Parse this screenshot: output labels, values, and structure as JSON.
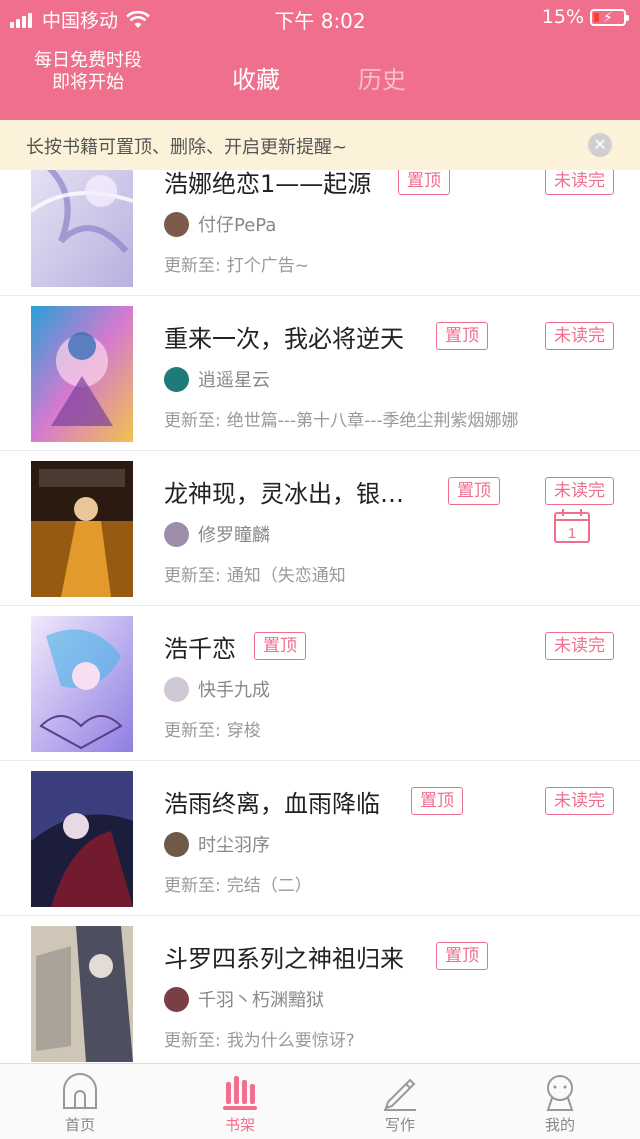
{
  "status_bar": {
    "carrier": "中国移动",
    "time": "下午 8:02",
    "battery": "15%"
  },
  "header": {
    "promo_line1": "每日免费时段",
    "promo_line2": "即将开始",
    "tabs": [
      {
        "label": "收藏",
        "active": true
      },
      {
        "label": "历史",
        "active": false
      }
    ]
  },
  "notice": {
    "text": "长按书籍可置顶、删除、开启更新提醒~"
  },
  "books": [
    {
      "title": "浩娜绝恋1——起源",
      "top_tag": "置顶",
      "unread_tag": "未读完",
      "author": "付仔PePa",
      "update_label": "更新至:",
      "update_text": "打个广告~"
    },
    {
      "title": "重来一次，我必将逆天",
      "top_tag": "置顶",
      "unread_tag": "未读完",
      "author": "逍遥星云",
      "update_label": "更新至:",
      "update_text": "绝世篇---第十八章---季绝尘荆紫烟娜娜"
    },
    {
      "title": "龙神现，灵冰出，银…",
      "top_tag": "置顶",
      "unread_tag": "未读完",
      "author": "修罗瞳麟",
      "update_label": "更新至:",
      "update_text": "通知（失恋通知",
      "calendar_number": "1"
    },
    {
      "title": "浩千恋",
      "top_tag": "置顶",
      "unread_tag": "未读完",
      "author": "快手九成",
      "update_label": "更新至:",
      "update_text": "穿梭"
    },
    {
      "title": "浩雨终离，血雨降临",
      "top_tag": "置顶",
      "unread_tag": "未读完",
      "author": "时尘羽序",
      "update_label": "更新至:",
      "update_text": "完结（二）"
    },
    {
      "title": "斗罗四系列之神祖归来",
      "top_tag": "置顶",
      "author": "千羽丶朽渊黯狱",
      "update_label": "更新至:",
      "update_text": "我为什么要惊讶?"
    }
  ],
  "tabbar": [
    {
      "label": "首页",
      "icon": "home-icon",
      "active": false
    },
    {
      "label": "书架",
      "icon": "bookshelf-icon",
      "active": true
    },
    {
      "label": "写作",
      "icon": "pencil-icon",
      "active": false
    },
    {
      "label": "我的",
      "icon": "profile-icon",
      "active": false
    }
  ],
  "colors": {
    "accent": "#ef6f8d",
    "notice_bg": "#fbf2d9"
  }
}
